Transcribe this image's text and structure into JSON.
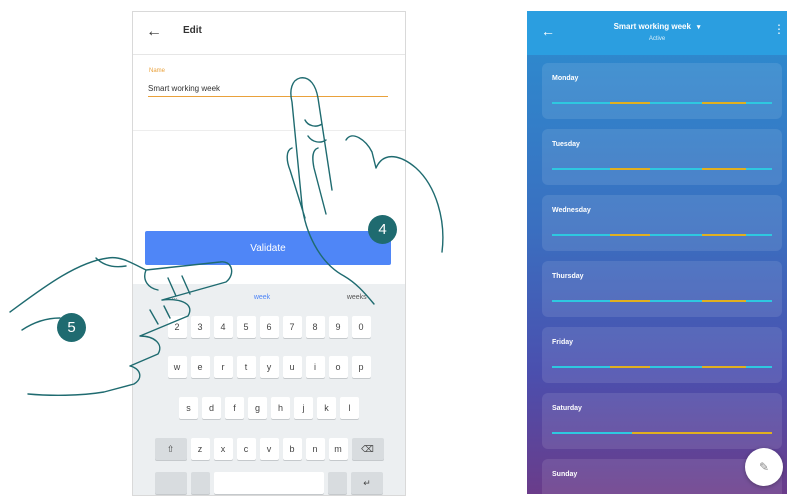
{
  "left_screen": {
    "header": {
      "back_icon": "←",
      "title": "Edit"
    },
    "form": {
      "name_label": "Name",
      "name_value": "Smart working week"
    },
    "validate_label": "Validate",
    "keyboard": {
      "suggestions": [
        "...",
        "week",
        "weeks"
      ],
      "row1": [
        "2",
        "3",
        "4",
        "5",
        "6",
        "7",
        "8",
        "9",
        "0"
      ],
      "row2": [
        "w",
        "e",
        "r",
        "t",
        "y",
        "u",
        "i",
        "o",
        "p"
      ],
      "row3": [
        "s",
        "d",
        "f",
        "g",
        "h",
        "j",
        "k",
        "l"
      ],
      "row4": [
        "z",
        "x",
        "c",
        "v",
        "b",
        "n",
        "m"
      ],
      "shift_icon": "⇧",
      "delete_icon": "⌫",
      "enter_icon": "↵"
    }
  },
  "step_badges": {
    "four": "4",
    "five": "5"
  },
  "right_screen": {
    "header": {
      "back_icon": "←",
      "title": "Smart working week",
      "caret_icon": "▾",
      "subtitle": "Active",
      "menu_icon": "⋮"
    },
    "days": [
      "Monday",
      "Tuesday",
      "Wednesday",
      "Thursday",
      "Friday",
      "Saturday",
      "Sunday"
    ],
    "fab_icon": "✎"
  },
  "colors": {
    "accent_orange": "#e9a13b",
    "button_blue": "#4f86f7",
    "badge_teal": "#1f6b70",
    "timeline_cyan": "#2ec8e0",
    "timeline_yellow": "#e0b020"
  }
}
